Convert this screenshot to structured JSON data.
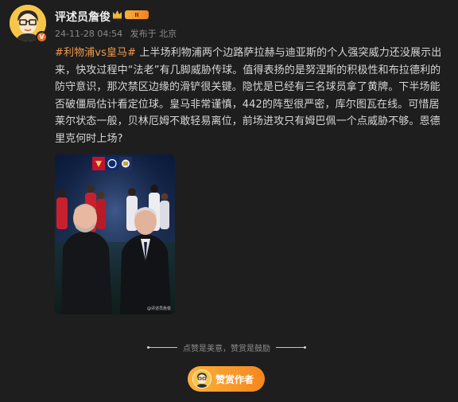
{
  "author": {
    "name": "评述员詹俊",
    "verified_badge": "V",
    "level_badge": "II",
    "timestamp": "24-11-28 04:54",
    "location": "发布于 北京"
  },
  "post": {
    "topic": "#利物浦vs皇马#",
    "body": "上半场利物浦两个边路萨拉赫与迪亚斯的个人强突威力还没展示出来，快攻过程中“法老”有几脚威胁传球。值得表扬的是努涅斯的积极性和布拉德利的防守意识，那次禁区边缘的滑铲很关键。隐忧是已经有三名球员拿了黄牌。下半场能否破僵局估计看定位球。皇马非常谨慎，442的阵型很严密，库尔图瓦在线。可惜居莱尔状态一般，贝林厄姆不敢轻易离位，前场进攻只有姆巴佩一个点威胁不够。恩德里克何时上场?",
    "image_watermark": "@评述员詹俊"
  },
  "reward": {
    "divider_text": "点赞是美意，赞赏是鼓励",
    "button_label": "赞赏作者"
  },
  "colors": {
    "background": "#1e1e1e",
    "topic": "#f09a4a",
    "button_start": "#ffb03b",
    "button_end": "#f5871e"
  }
}
